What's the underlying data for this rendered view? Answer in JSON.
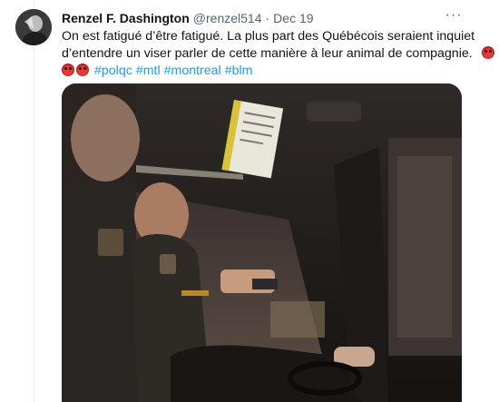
{
  "tweet": {
    "author": {
      "name": "Renzel F. Dashington",
      "handle": "@renzel514",
      "avatar_icon": "profile-photo"
    },
    "separator": "·",
    "date": "Dec 19",
    "more_icon": "ellipsis-icon",
    "text_lines": [
      "On est fatigué d’être fatigué.  La plus part des Québécois seraient inquiet",
      "d’entendre un viser parler de cette manière à leur animal de compagnie."
    ],
    "emoji": "pouting-face",
    "hashtags": [
      "#polqc",
      "#mtl",
      "#montreal",
      "#blm"
    ],
    "media": {
      "type": "video-still",
      "description_icon": "police-car-window-scene"
    }
  },
  "colors": {
    "text": "#0f1419",
    "muted": "#536471",
    "link": "#1d9bf0",
    "divider": "#e7e9ea"
  }
}
